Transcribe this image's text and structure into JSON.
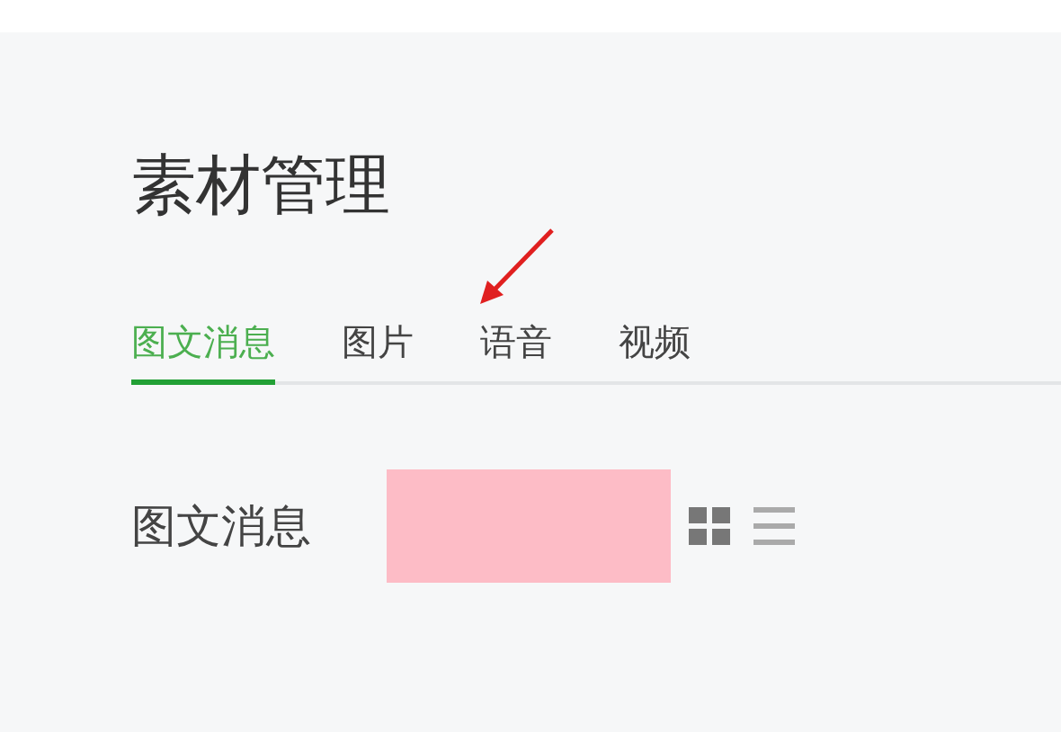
{
  "title": "素材管理",
  "tabs": [
    {
      "label": "图文消息",
      "selected": true
    },
    {
      "label": "图片",
      "selected": false
    },
    {
      "label": "语音",
      "selected": false
    },
    {
      "label": "视频",
      "selected": false
    }
  ],
  "section": {
    "heading": "图文消息",
    "views": [
      {
        "kind": "grid",
        "selected": true
      },
      {
        "kind": "list",
        "selected": false
      }
    ]
  }
}
